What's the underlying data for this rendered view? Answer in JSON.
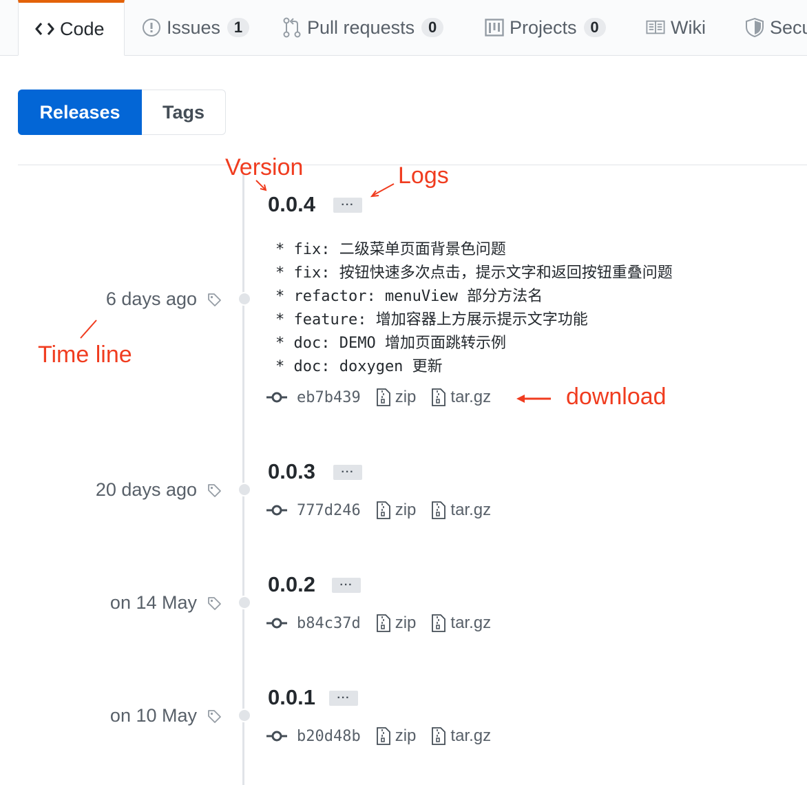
{
  "nav": {
    "tabs": [
      {
        "label": "Code",
        "icon": "code-icon",
        "selected": true
      },
      {
        "label": "Issues",
        "icon": "issue-icon",
        "count": "1"
      },
      {
        "label": "Pull requests",
        "icon": "pull-request-icon",
        "count": "0"
      },
      {
        "label": "Projects",
        "icon": "project-icon",
        "count": "0"
      },
      {
        "label": "Wiki",
        "icon": "book-icon"
      },
      {
        "label": "Secu",
        "icon": "shield-icon"
      }
    ]
  },
  "subnav": {
    "releases_label": "Releases",
    "tags_label": "Tags"
  },
  "releases": [
    {
      "date": "6 days ago",
      "version": "0.0.4",
      "ellipsis": "···",
      "notes": [
        "* fix: 二级菜单页面背景色问题",
        "* fix: 按钮快速多次点击，提示文字和返回按钮重叠问题",
        "* refactor: menuView 部分方法名",
        "* feature: 增加容器上方展示提示文字功能",
        "* doc: DEMO 增加页面跳转示例",
        "* doc: doxygen 更新"
      ],
      "commit": "eb7b439",
      "zip_label": "zip",
      "targz_label": "tar.gz"
    },
    {
      "date": "20 days ago",
      "version": "0.0.3",
      "ellipsis": "···",
      "commit": "777d246",
      "zip_label": "zip",
      "targz_label": "tar.gz"
    },
    {
      "date": "on 14 May",
      "version": "0.0.2",
      "ellipsis": "···",
      "commit": "b84c37d",
      "zip_label": "zip",
      "targz_label": "tar.gz"
    },
    {
      "date": "on 10 May",
      "version": "0.0.1",
      "ellipsis": "···",
      "commit": "b20d48b",
      "zip_label": "zip",
      "targz_label": "tar.gz"
    }
  ],
  "annotations": {
    "version": "Version",
    "logs": "Logs",
    "timeline": "Time line",
    "download": "download",
    "color": "#f03c1f"
  },
  "colors": {
    "accent": "#0366d6",
    "tab_highlight": "#e36209"
  }
}
